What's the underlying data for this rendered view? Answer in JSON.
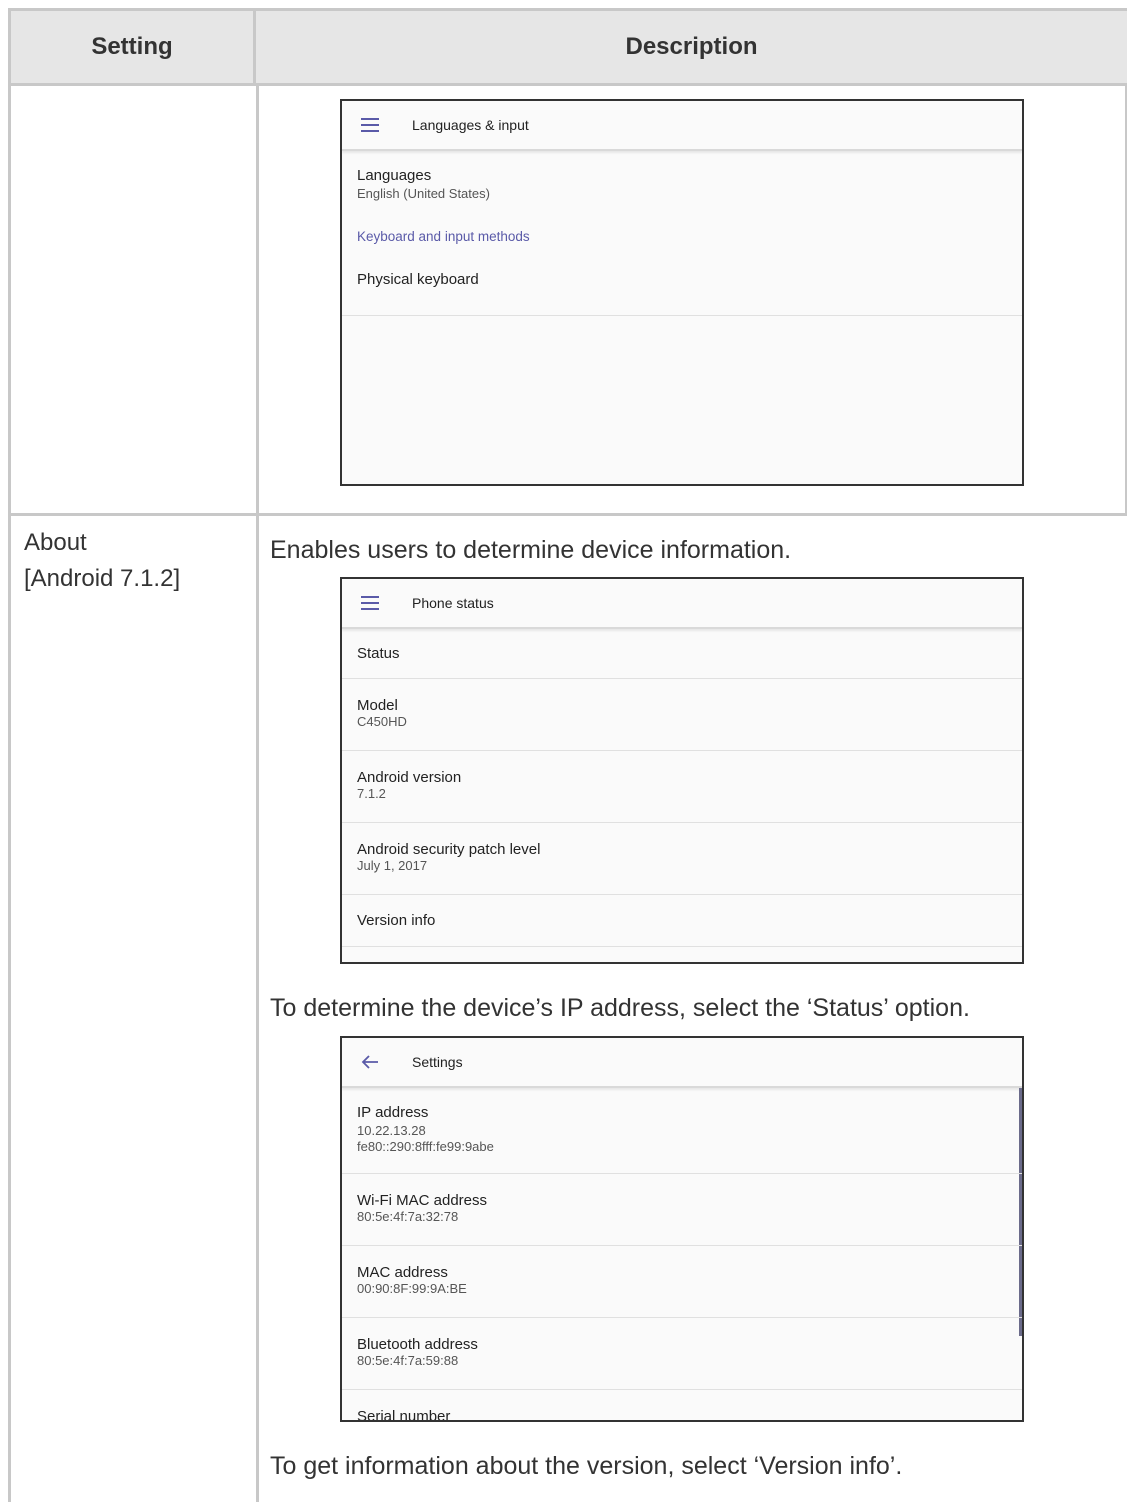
{
  "table": {
    "header": {
      "setting": "Setting",
      "description": "Description"
    },
    "about_row": {
      "setting": "About [Android 7.1.2]",
      "intro": "Enables users to determine device information.",
      "ip_instruction": "To determine the device’s IP address, select the ‘Status’ option.",
      "version_instruction": "To get information about the version, select ‘Version info’."
    }
  },
  "languages_screen": {
    "title": "Languages & input",
    "menu_icon": "hamburger-menu-icon",
    "languages_title": "Languages",
    "languages_value": "English (United States)",
    "category": "Keyboard and input methods",
    "physical_keyboard": "Physical keyboard",
    "accent": "#5a5aa8"
  },
  "phone_status_screen": {
    "title": "Phone status",
    "menu_icon": "hamburger-menu-icon",
    "items": [
      {
        "title": "Status",
        "value": ""
      },
      {
        "title": "Model",
        "value": "C450HD"
      },
      {
        "title": "Android version",
        "value": "7.1.2"
      },
      {
        "title": "Android security patch level",
        "value": "July 1, 2017"
      },
      {
        "title": "Version info",
        "value": ""
      }
    ]
  },
  "settings_screen": {
    "title": "Settings",
    "back_icon": "back-arrow-icon",
    "ip": {
      "title": "IP address",
      "v4": "10.22.13.28",
      "v6": "fe80::290:8fff:fe99:9abe"
    },
    "wifi_mac": {
      "title": "Wi-Fi MAC address",
      "value": "80:5e:4f:7a:32:78"
    },
    "mac": {
      "title": "MAC address",
      "value": "00:90:8F:99:9A:BE"
    },
    "bt": {
      "title": "Bluetooth address",
      "value": "80:5e:4f:7a:59:88"
    },
    "serial": {
      "title": "Serial number"
    }
  }
}
